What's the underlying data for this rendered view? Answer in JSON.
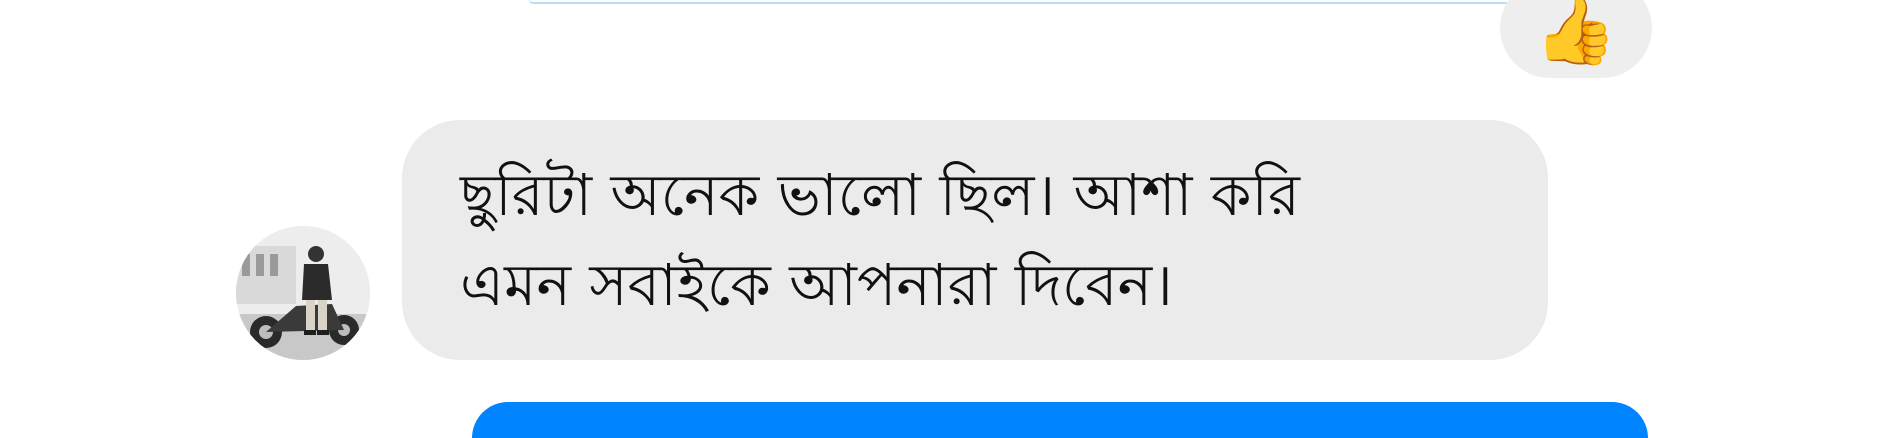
{
  "thread": {
    "previous_reaction": {
      "emoji": "👍",
      "icon": "thumbs-up-icon",
      "color": "#f6b21a"
    },
    "received_message": {
      "text": "ছুরিটা অনেক ভালো ছিল। আশা করি\nএমন সবাইকে আপনারা দিবেন।",
      "bubble_color": "#ebebeb"
    },
    "sent_bubble_color": "#0084ff"
  }
}
